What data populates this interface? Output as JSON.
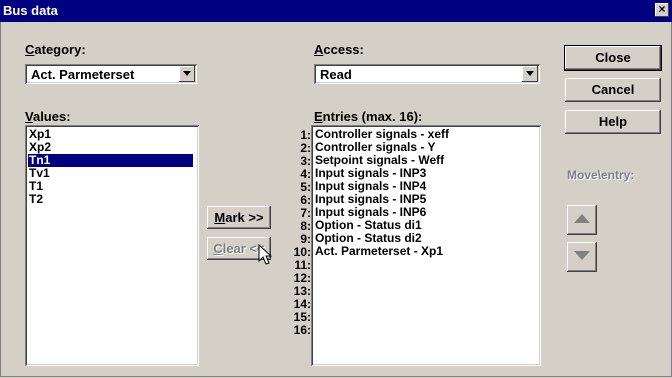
{
  "window": {
    "title": "Bus data",
    "close_glyph": "×"
  },
  "category": {
    "label_accel": "C",
    "label_rest": "ategory:",
    "value": "Act. Parmeterset"
  },
  "access": {
    "label_accel": "A",
    "label_rest": "ccess:",
    "value": "Read"
  },
  "values": {
    "label_accel": "V",
    "label_rest": "alues:",
    "items": [
      "Xp1",
      "Xp2",
      "Tn1",
      "Tv1",
      "T1",
      "T2"
    ],
    "selected_index": 2
  },
  "entries": {
    "label_accel": "E",
    "label_rest": "ntries (max. 16):",
    "numbers": [
      "1:",
      "2:",
      "3:",
      "4:",
      "5:",
      "6:",
      "7:",
      "8:",
      "9:",
      "10:",
      "11:",
      "12:",
      "13:",
      "14:",
      "15:",
      "16:"
    ],
    "items": [
      "Controller signals - xeff",
      "Controller signals - Y",
      "Setpoint signals - Weff",
      "Input signals - INP3",
      "Input signals - INP4",
      "Input signals - INP5",
      "Input signals - INP6",
      "Option - Status di1",
      "Option - Status di2",
      "Act. Parmeterset - Xp1"
    ]
  },
  "buttons": {
    "close": "Close",
    "cancel": "Cancel",
    "help": "Help",
    "mark_accel": "M",
    "mark_rest": "ark >>",
    "clear_accel": "C",
    "clear_rest": "lear <<"
  },
  "move_entry": {
    "label": "Move\\entry:",
    "up_icon": "arrow-up-icon",
    "down_icon": "arrow-down-icon"
  }
}
